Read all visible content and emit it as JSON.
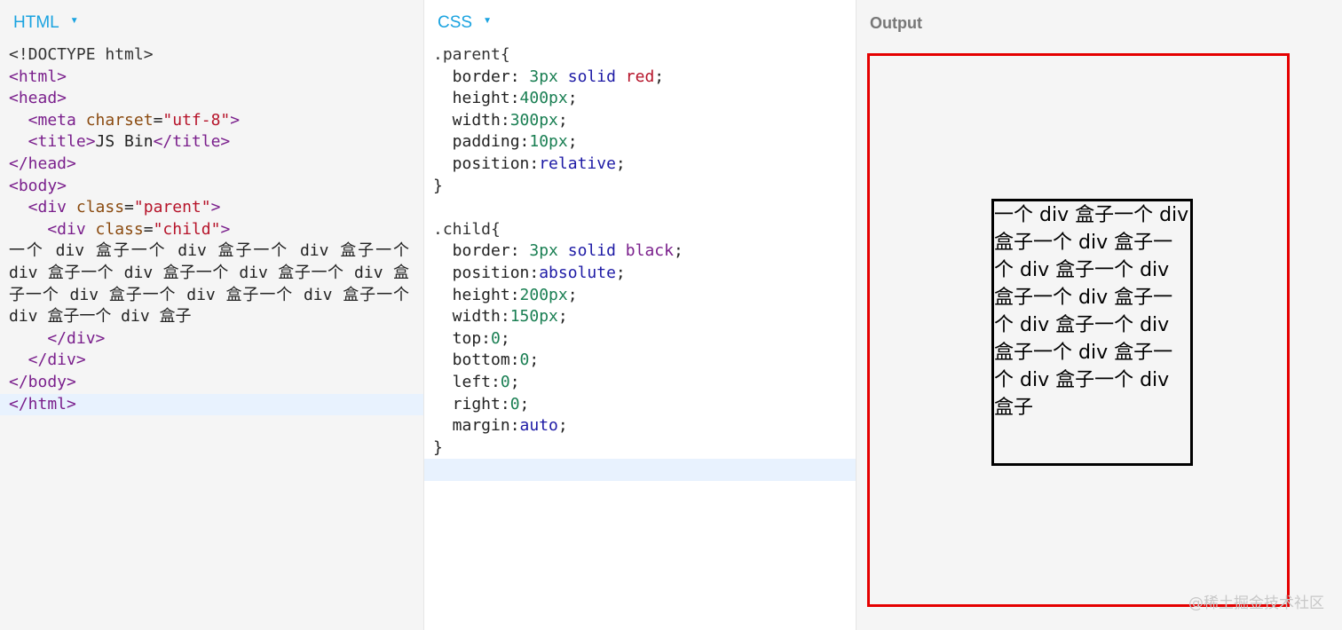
{
  "html_panel": {
    "title": "HTML",
    "code_lines": [
      "<!DOCTYPE html>",
      "<html>",
      "<head>",
      "  <meta charset=\"utf-8\">",
      "  <title>JS Bin</title>",
      "</head>",
      "<body>",
      "  <div class=\"parent\">",
      "    <div class=\"child\">",
      "      一个 div 盒子一个 div 盒子一个 div 盒子一个 div 盒子一个 div 盒子一个 div 盒子一个 div 盒子一个 div 盒子一个 div 盒子一个 div 盒子一个 div 盒子一个 div 盒子",
      "    </div>",
      "  </div>",
      "</body>",
      "</html>"
    ]
  },
  "css_panel": {
    "title": "CSS",
    "code_lines": [
      ".parent{",
      "  border: 3px solid red;",
      "  height:400px;",
      "  width:300px;",
      "  padding:10px;",
      "  position:relative;",
      "}",
      "",
      ".child{",
      "  border: 3px solid black;",
      "  position:absolute;",
      "  height:200px;",
      "  width:150px;",
      "  top:0;",
      "  bottom:0;",
      "  left:0;",
      "  right:0;",
      "  margin:auto;",
      "}"
    ]
  },
  "output_panel": {
    "title": "Output",
    "child_text": "一个 div 盒子一个 div 盒子一个 div 盒子一个 div 盒子一个 div 盒子一个 div 盒子一个 div 盒子一个 div 盒子一个 div 盒子一个 div 盒子一个 div 盒子",
    "parent_border_color": "#e50000",
    "child_border_color": "#000000"
  },
  "watermark": "@稀土掘金技术社区",
  "colors": {
    "tab_accent": "#1aa3e0",
    "tag": "#7a1f8c",
    "attribute": "#8a4a0f",
    "string": "#b6142a",
    "number": "#1a7f53",
    "keyword": "#1d1aa5",
    "active_line": "#e8f2fe"
  }
}
